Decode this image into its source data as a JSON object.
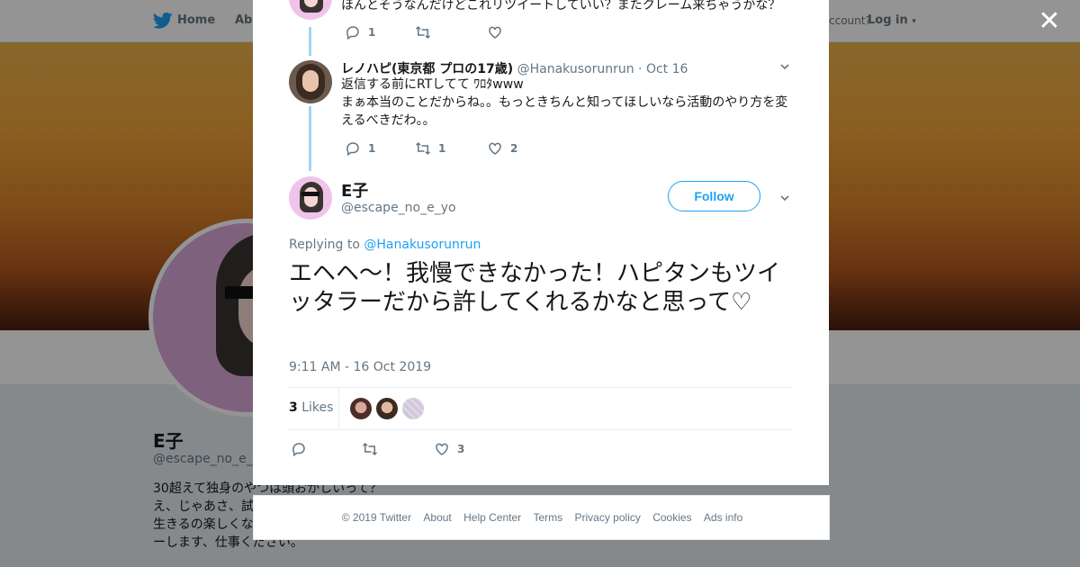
{
  "topbar": {
    "home_label": "Home",
    "about_label": "Abo",
    "have_account_text": "ccount?",
    "login_label": "Log in"
  },
  "profile": {
    "name": "E子",
    "handle": "@escape_no_e_y",
    "bio": "30超えて独身のやつは頭おかしいって？え、じゃあさ、試 てみ？絶対頭おか いて生きるの楽しくなってくるから。フ イターします、仕事ください。"
  },
  "thread": [
    {
      "text": "ほんとそうなんだけどこれリツイートしていい？またクレーム来ちゃうかな？",
      "replies": "1",
      "retweets": "",
      "likes": ""
    },
    {
      "name": "レノハピ(東京都 プロの17歳)",
      "handle": "@Hanakusorunrun",
      "date": "· Oct 16",
      "text_line1": "返信する前にRTしてて ﾜﾛﾀwww",
      "text_line2": "まぁ本当のことだからね。。もっときちんと知ってほしいなら活動のやり方を変えるべきだわ。。",
      "replies": "1",
      "retweets": "1",
      "likes": "2"
    }
  ],
  "main_tweet": {
    "name": "E子",
    "handle": "@escape_no_e_yo",
    "follow_label": "Follow",
    "replying_prefix": "Replying to",
    "replying_to": "@Hanakusorunrun",
    "text": "エヘヘ〜！我慢できなかった！ハピタンもツイッタラーだから許してくれるかなと思って♡",
    "timestamp": "9:11 AM - 16 Oct 2019",
    "likes_count": "3",
    "likes_label": "Likes",
    "action_likes": "3"
  },
  "footer": {
    "links": [
      "© 2019 Twitter",
      "About",
      "Help Center",
      "Terms",
      "Privacy policy",
      "Cookies",
      "Ads info"
    ]
  },
  "colors": {
    "accent": "#1da1f2",
    "thread_line": "#9fd6f5",
    "muted": "#657786"
  }
}
